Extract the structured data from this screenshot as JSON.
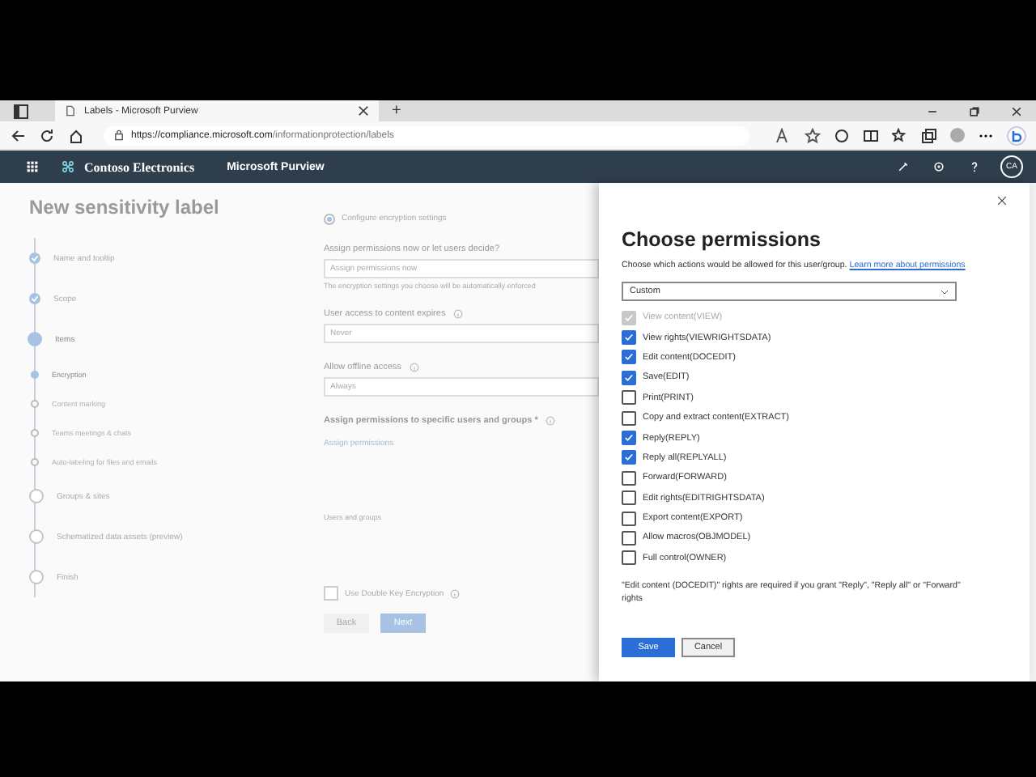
{
  "browser": {
    "tab_title": "Labels - Microsoft Purview",
    "new_tab": "+",
    "url_host": "https://compliance.microsoft.com",
    "url_path": "/informationprotection/labels"
  },
  "app_header": {
    "org": "Contoso Electronics",
    "product": "Microsoft Purview",
    "user_initials": "CA"
  },
  "page": {
    "title": "New sensitivity label",
    "steps": [
      {
        "label": "Name and tooltip",
        "kind": "done"
      },
      {
        "label": "Scope",
        "kind": "done"
      },
      {
        "label": "Items",
        "kind": "current",
        "children": [
          {
            "label": "Encryption",
            "selected": true
          },
          {
            "label": "Content marking",
            "selected": false
          },
          {
            "label": "Teams meetings & chats",
            "selected": false
          },
          {
            "label": "Auto-labeling for files and emails",
            "selected": false
          }
        ]
      },
      {
        "label": "Groups & sites",
        "kind": "todo"
      },
      {
        "label": "Schematized data assets (preview)",
        "kind": "todo"
      },
      {
        "label": "Finish",
        "kind": "todo"
      }
    ],
    "configure_option": "Configure encryption settings",
    "configure_selected": true,
    "assign_label": "Assign permissions now or let users decide?",
    "assign_value": "Assign permissions now",
    "assign_note": "The encryption settings you choose will be automatically enforced",
    "expires_label": "User access to content expires",
    "expires_value": "Never",
    "offline_label": "Allow offline access",
    "offline_value": "Always",
    "specific_label": "Assign permissions to specific users and groups *",
    "assign_link": "Assign permissions",
    "users_header": "Users and groups",
    "dke_label": "Use Double Key Encryption",
    "dke_checked": false,
    "back": "Back",
    "next": "Next"
  },
  "panel": {
    "title": "Choose permissions",
    "subtitle": "Choose which actions would be allowed for this user/group.",
    "link": "Learn more about permissions",
    "preset": "Custom",
    "permissions": [
      {
        "label": "View content(VIEW)",
        "checked": true,
        "disabled": true
      },
      {
        "label": "View rights(VIEWRIGHTSDATA)",
        "checked": true,
        "disabled": false
      },
      {
        "label": "Edit content(DOCEDIT)",
        "checked": true,
        "disabled": false
      },
      {
        "label": "Save(EDIT)",
        "checked": true,
        "disabled": false
      },
      {
        "label": "Print(PRINT)",
        "checked": false,
        "disabled": false
      },
      {
        "label": "Copy and extract content(EXTRACT)",
        "checked": false,
        "disabled": false
      },
      {
        "label": "Reply(REPLY)",
        "checked": true,
        "disabled": false
      },
      {
        "label": "Reply all(REPLYALL)",
        "checked": true,
        "disabled": false
      },
      {
        "label": "Forward(FORWARD)",
        "checked": false,
        "disabled": false
      },
      {
        "label": "Edit rights(EDITRIGHTSDATA)",
        "checked": false,
        "disabled": false
      },
      {
        "label": "Export content(EXPORT)",
        "checked": false,
        "disabled": false
      },
      {
        "label": "Allow macros(OBJMODEL)",
        "checked": false,
        "disabled": false
      },
      {
        "label": "Full control(OWNER)",
        "checked": false,
        "disabled": false
      }
    ],
    "note": "\"Edit content (DOCEDIT)\" rights are required if you grant \"Reply\", \"Reply all\" or \"Forward\" rights",
    "save": "Save",
    "cancel": "Cancel"
  }
}
